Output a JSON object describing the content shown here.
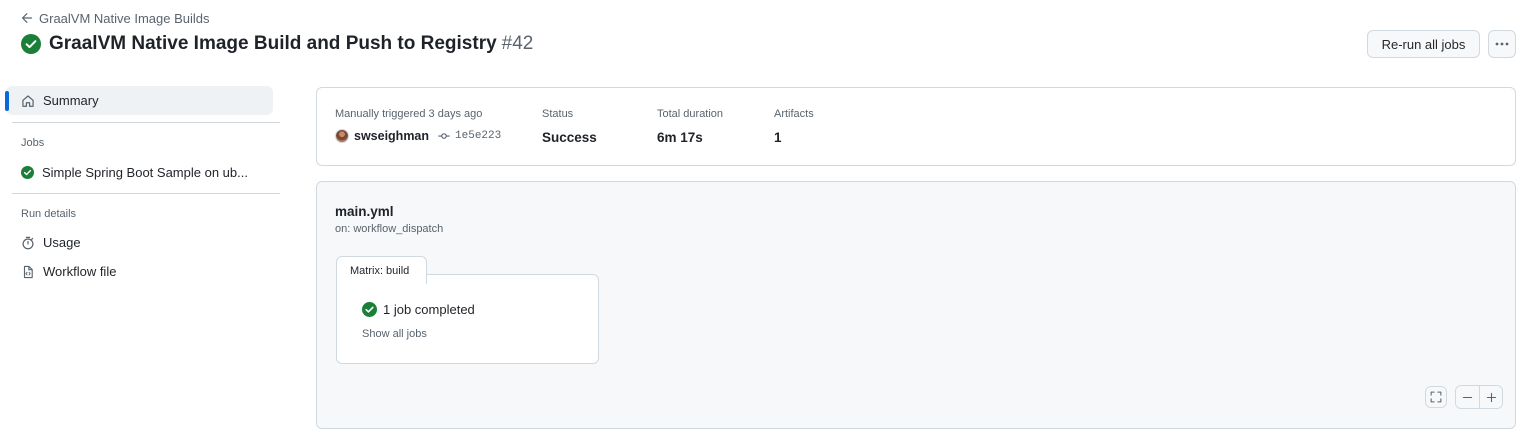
{
  "header": {
    "back_label": "GraalVM Native Image Builds",
    "title": "GraalVM Native Image Build and Push to Registry",
    "run_number": "#42",
    "rerun_label": "Re-run all jobs"
  },
  "sidebar": {
    "summary_label": "Summary",
    "jobs_heading": "Jobs",
    "jobs": [
      {
        "label": "Simple Spring Boot Sample on ub...",
        "status": "success"
      }
    ],
    "run_details_heading": "Run details",
    "usage_label": "Usage",
    "workflow_file_label": "Workflow file"
  },
  "summary": {
    "trigger_label": "Manually triggered 3 days ago",
    "actor": "swseighman",
    "commit": "1e5e223",
    "status_label": "Status",
    "status_value": "Success",
    "duration_label": "Total duration",
    "duration_value": "6m 17s",
    "artifacts_label": "Artifacts",
    "artifacts_value": "1"
  },
  "graph": {
    "workflow_file": "main.yml",
    "trigger": "on: workflow_dispatch",
    "matrix_label": "Matrix: build",
    "job_status": "1 job completed",
    "show_all": "Show all jobs"
  },
  "colors": {
    "success": "#1a7f37",
    "accent": "#0969da",
    "border": "#d1d9e0",
    "muted": "#59636e"
  }
}
